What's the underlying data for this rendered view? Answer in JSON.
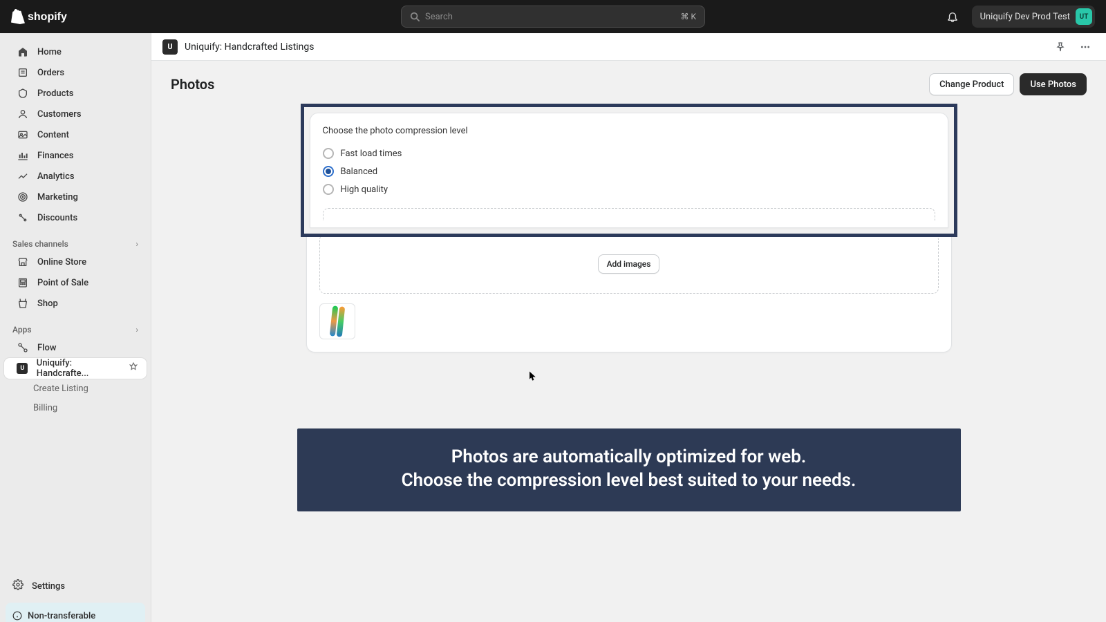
{
  "header": {
    "search_placeholder": "Search",
    "search_shortcut": "⌘ K",
    "account_name": "Uniquify Dev Prod Test",
    "account_initials": "UT"
  },
  "sidebar": {
    "items": [
      {
        "label": "Home"
      },
      {
        "label": "Orders"
      },
      {
        "label": "Products"
      },
      {
        "label": "Customers"
      },
      {
        "label": "Content"
      },
      {
        "label": "Finances"
      },
      {
        "label": "Analytics"
      },
      {
        "label": "Marketing"
      },
      {
        "label": "Discounts"
      }
    ],
    "sales_label": "Sales channels",
    "sales": [
      {
        "label": "Online Store"
      },
      {
        "label": "Point of Sale"
      },
      {
        "label": "Shop"
      }
    ],
    "apps_label": "Apps",
    "apps": [
      {
        "label": "Flow"
      },
      {
        "label": "Uniquify: Handcrafte..."
      }
    ],
    "app_sub": [
      {
        "label": "Create Listing"
      },
      {
        "label": "Billing"
      }
    ],
    "settings_label": "Settings",
    "nontrans_label": "Non-transferable"
  },
  "appbar": {
    "title": "Uniquify: Handcrafted Listings"
  },
  "page": {
    "title": "Photos",
    "change_btn": "Change Product",
    "use_btn": "Use Photos"
  },
  "card": {
    "label": "Choose the photo compression level",
    "options": [
      "Fast load times",
      "Balanced",
      "High quality"
    ],
    "selected_index": 1,
    "add_images": "Add images"
  },
  "banner": {
    "line1": "Photos are automatically optimized for web.",
    "line2": "Choose the compression level best suited to your needs."
  }
}
